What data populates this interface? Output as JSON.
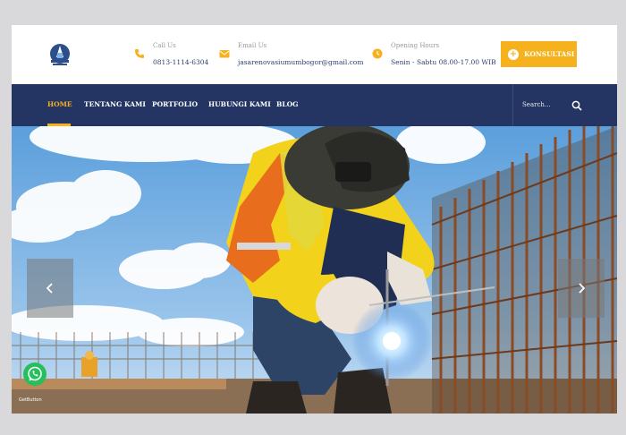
{
  "header": {
    "call": {
      "label": "Call Us",
      "value": "0813-1114-6304"
    },
    "email": {
      "label": "Email Us",
      "value": "jasarenovasiumumbogor@gmail.com"
    },
    "hours": {
      "label": "Opening Hours",
      "value": "Senin - Sabtu 08.00-17.00 WIB"
    },
    "cta_label": "KONSULTASI"
  },
  "nav": {
    "items": [
      {
        "label": "HOME",
        "active": true
      },
      {
        "label": "TENTANG KAMI"
      },
      {
        "label": "PORTFOLIO"
      },
      {
        "label": "HUBUNGI KAMI"
      },
      {
        "label": "BLOG"
      }
    ],
    "search_placeholder": "Search..."
  },
  "hero": {
    "image_alt": "welder with protective mask working on steel rebar"
  },
  "whatsapp": {
    "caption": "GetButton"
  },
  "colors": {
    "navy": "#243563",
    "accent": "#f6b21c",
    "whatsapp": "#25c05c"
  },
  "icons": [
    "logo-icon",
    "phone-icon",
    "mail-icon",
    "clock-icon",
    "plus-icon",
    "search-icon",
    "chevron-left-icon",
    "chevron-right-icon",
    "whatsapp-icon"
  ]
}
